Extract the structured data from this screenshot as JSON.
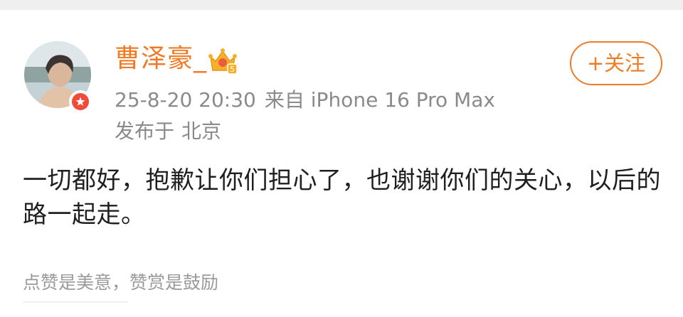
{
  "post": {
    "author": {
      "name": "曹泽豪_",
      "avatar_icon": "avatar-image",
      "verified_icon": "verified-badge-icon",
      "vip_icon": "vip-crown-icon",
      "vip_level": "5"
    },
    "timestamp": "25-8-20 20:30",
    "source": "来自 iPhone 16 Pro Max",
    "location_prefix": "发布于",
    "location": "北京",
    "follow_label": "+关注",
    "text": "一切都好，抱歉让你们担心了，也谢谢你们的关心，以后的路一起走。"
  },
  "reward": {
    "hint": "点赞是美意，赞赏是鼓励"
  },
  "colors": {
    "accent": "#f07b25",
    "meta_text": "#8a8a8a",
    "body_text": "#1f1f1f",
    "verified": "#f04a3a"
  }
}
